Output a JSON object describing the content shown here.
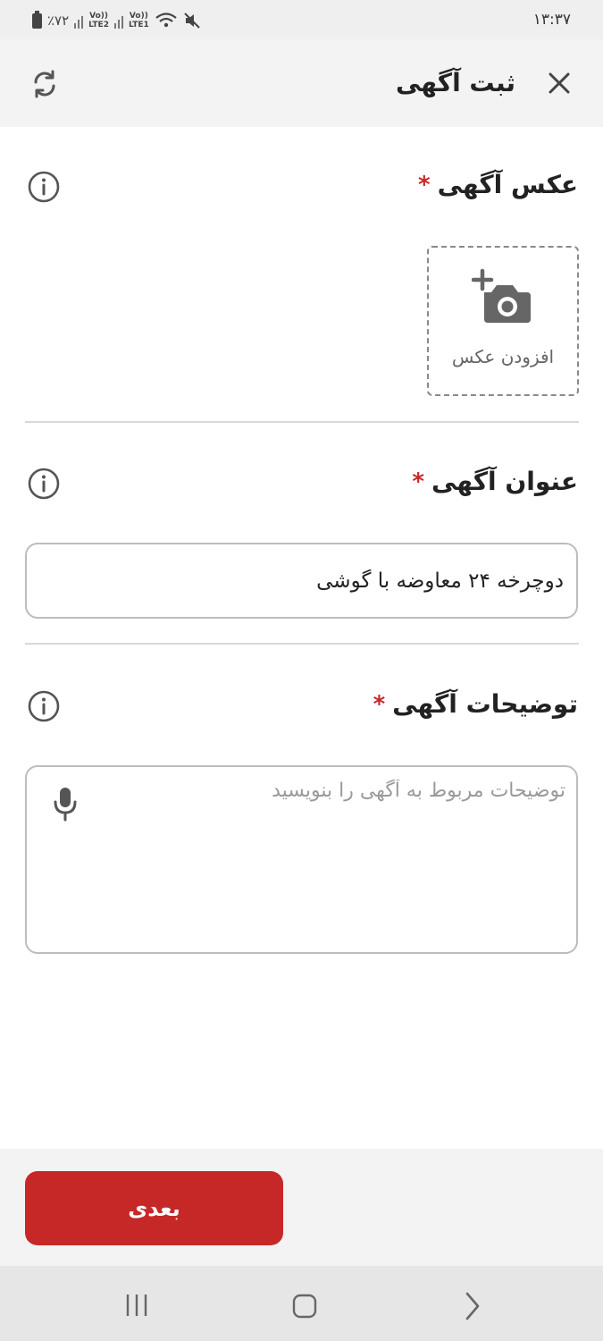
{
  "status_bar": {
    "time": "۱۳:۳۷",
    "battery": "٪۷۲",
    "sim1": "LTE2",
    "sim2": "LTE1",
    "volte": "Vo))"
  },
  "header": {
    "title": "ثبت آگهی",
    "close_icon": "close-icon",
    "refresh_icon": "refresh-icon"
  },
  "photo_section": {
    "label": "عکس آگهی",
    "required": "*",
    "add_photo_label": "افزودن عکس"
  },
  "title_section": {
    "label": "عنوان آگهی",
    "required": "*",
    "value": "دوچرخه ۲۴ معاوضه با گوشی"
  },
  "description_section": {
    "label": "توضیحات آگهی",
    "required": "*",
    "placeholder": "توضیحات مربوط به آگهی را بنویسید"
  },
  "footer": {
    "next_label": "بعدی"
  },
  "colors": {
    "accent": "#c62828",
    "header_bg": "#f3f3f3",
    "border": "#bdbdbd"
  }
}
